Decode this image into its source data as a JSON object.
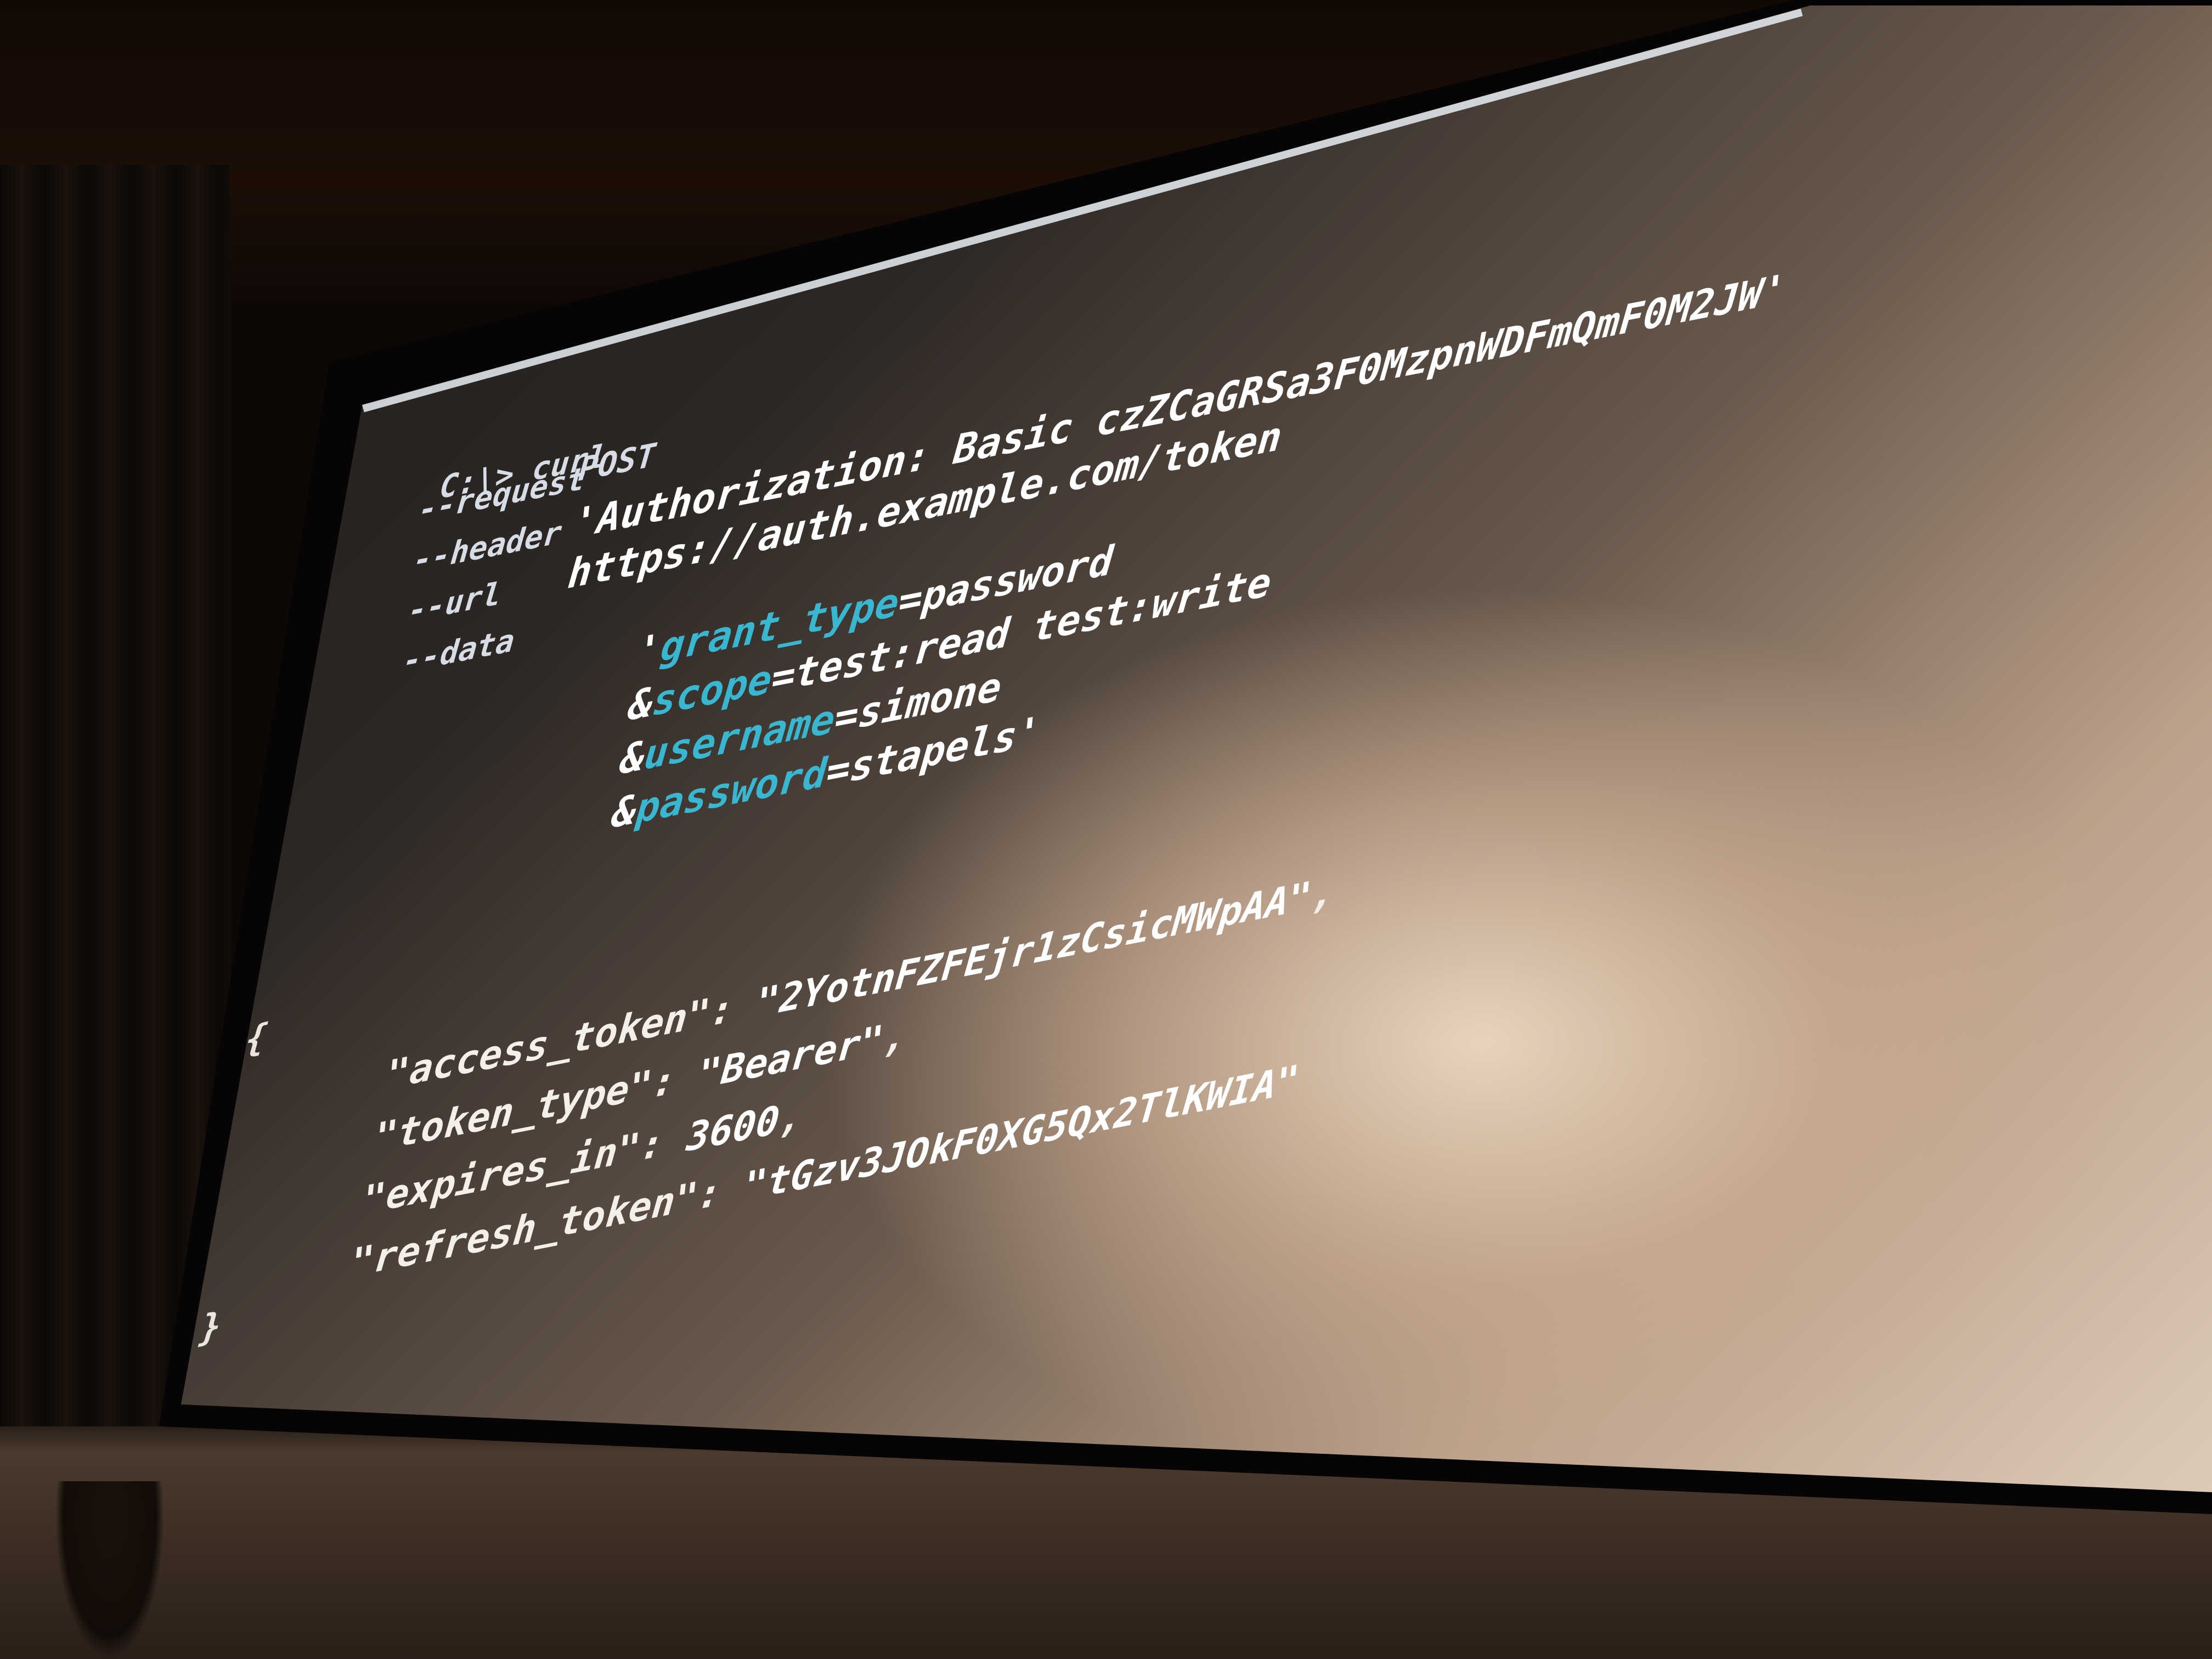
{
  "terminal": {
    "prompt": "C:\\>",
    "command": "curl",
    "options": [
      {
        "flag": "--request",
        "value": "POST"
      },
      {
        "flag": "--header",
        "value": "'Authorization: Basic czZCaGRSa3F0MzpnWDFmQmF0M2JW'"
      },
      {
        "flag": "--url",
        "value": "https://auth.example.com/token"
      },
      {
        "flag": "--data",
        "value": "'"
      }
    ],
    "data_params": [
      {
        "prefix": "'",
        "key": "grant_type",
        "eq": "=",
        "value": "password"
      },
      {
        "prefix": "&",
        "key": "scope",
        "eq": "=",
        "value": "test:read test:write"
      },
      {
        "prefix": "&",
        "key": "username",
        "eq": "=",
        "value": "simone"
      },
      {
        "prefix": "&",
        "key": "password",
        "eq": "=",
        "value": "stapels'"
      }
    ]
  },
  "response": {
    "open_brace": "{",
    "close_brace": "}",
    "fields": [
      {
        "key": "\"access_token\"",
        "sep": ": ",
        "value": "\"2YotnFZFEjr1zCsicMWpAA\"",
        "trail": ","
      },
      {
        "key": "\"token_type\"",
        "sep": ": ",
        "value": "\"Bearer\"",
        "trail": ","
      },
      {
        "key": "\"expires_in\"",
        "sep": ": ",
        "value": "3600",
        "trail": ","
      },
      {
        "key": "\"refresh_token\"",
        "sep": ": ",
        "value": "\"tGzv3JOkF0XG5Qx2TlKWIA\"",
        "trail": ""
      }
    ]
  }
}
